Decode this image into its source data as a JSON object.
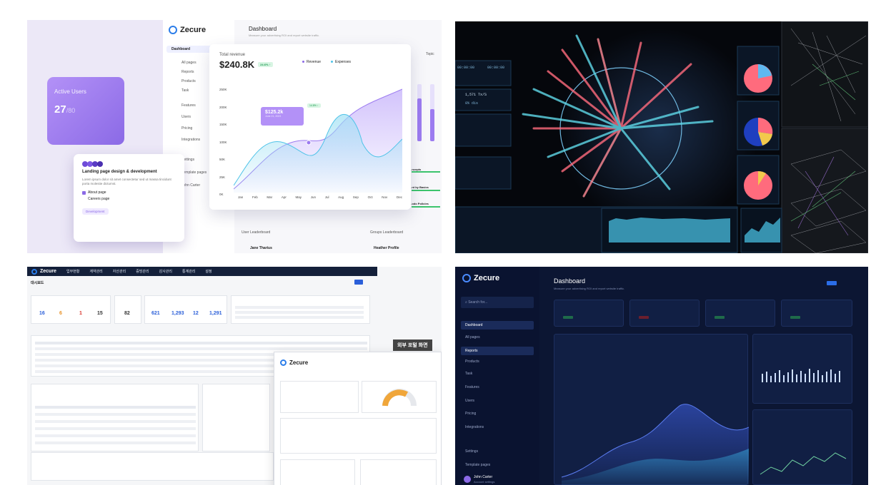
{
  "panel1": {
    "brand": "Zecure",
    "title": "Dashboard",
    "subtitle": "Measure your advertising ROI and report website traffic.",
    "nav": [
      "Dashboard",
      "All pages",
      "Reports",
      "Products",
      "Task",
      "Features",
      "Users",
      "Pricing",
      "Integrations",
      "Settings",
      "Template pages",
      "John Carter"
    ],
    "active_users": {
      "label": "Active Users",
      "value": "27",
      "total": "/80"
    },
    "task": {
      "title": "Landing page design & development",
      "desc": "Lorem ipsum dolor sit amet consectetur sed ut massa tincidunt porta molestie dictumst.",
      "check1": "About page",
      "check2": "Careers page",
      "tag": "Development"
    },
    "revenue": {
      "label": "Total revenue",
      "value": "$240.8K",
      "delta": "24.6% ↑",
      "legend_revenue": "Revenue",
      "legend_expenses": "Expenses",
      "tooltip_value": "$125.2k",
      "tooltip_sub": "June 21, 2023",
      "tooltip_badge": "14.8% ↑",
      "yticks": [
        "250K",
        "200K",
        "150K",
        "100K",
        "50K",
        "25K",
        "0K"
      ],
      "months": [
        "Jan",
        "Feb",
        "Mar",
        "Apr",
        "May",
        "Jun",
        "Jul",
        "Aug",
        "Sep",
        "Oct",
        "Nov",
        "Dec"
      ]
    },
    "leaderboard_user": "User Leaderboard",
    "leaderboard_group": "Groups Leaderboard",
    "right_snippets": [
      "Topic",
      "...ncepts",
      "...nt by Basics",
      "...odo Policies"
    ],
    "lb_name": "Jane Tharius",
    "lb_name2": "Heather Profile"
  },
  "panel2": {
    "time1": "00:00:00",
    "time2": "00:00:00",
    "stat": "1,571 Tx/S",
    "stat2": "0% dis"
  },
  "panel3": {
    "brand": "Zecure",
    "nav": [
      "업무현황",
      "계약관리",
      "자산관리",
      "증빙관리",
      "감사관리",
      "통계관리",
      "설정"
    ],
    "page": "대시보드",
    "badge": "외부 포털 화면",
    "summary_nums": [
      "16",
      "6",
      "1",
      "15",
      "82",
      "621",
      "1,293",
      "12",
      "1,291"
    ]
  },
  "panel4": {
    "brand": "Zecure",
    "title": "Dashboard",
    "subtitle": "Measure your advertising ROI and report website traffic.",
    "search": "Search for...",
    "nav": [
      "Dashboard",
      "All pages",
      "Reports",
      "Products",
      "Task",
      "Features",
      "Users",
      "Pricing",
      "Integrations",
      "Settings",
      "Template pages"
    ],
    "user": "John Carter",
    "user_sub": "Account settings"
  }
}
